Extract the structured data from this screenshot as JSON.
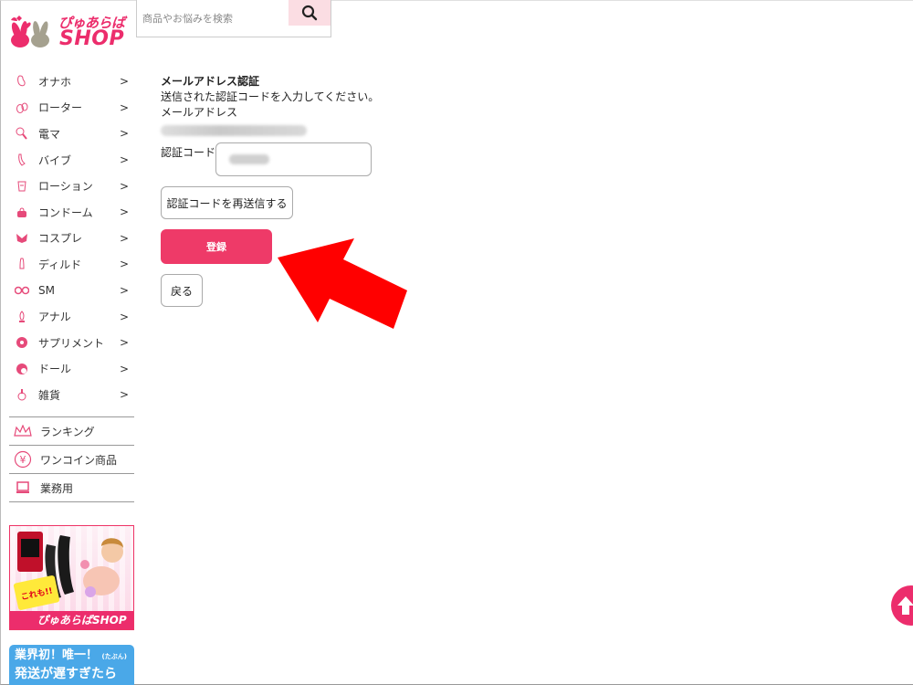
{
  "header": {
    "logo_text_jp": "ぴゅあらば",
    "logo_text_en": "SHOP",
    "search_placeholder": "商品やお悩みを検索"
  },
  "sidebar": {
    "categories": [
      {
        "label": "オナホ",
        "arrow": ">",
        "icon": "onahole-icon"
      },
      {
        "label": "ローター",
        "arrow": ">",
        "icon": "rotor-icon"
      },
      {
        "label": "電マ",
        "arrow": ">",
        "icon": "massager-icon"
      },
      {
        "label": "バイブ",
        "arrow": ">",
        "icon": "vibe-icon"
      },
      {
        "label": "ローション",
        "arrow": ">",
        "icon": "lotion-icon"
      },
      {
        "label": "コンドーム",
        "arrow": ">",
        "icon": "condom-icon"
      },
      {
        "label": "コスプレ",
        "arrow": ">",
        "icon": "cosplay-icon"
      },
      {
        "label": "ディルド",
        "arrow": ">",
        "icon": "dildo-icon"
      },
      {
        "label": "SM",
        "arrow": ">",
        "icon": "sm-icon"
      },
      {
        "label": "アナル",
        "arrow": ">",
        "icon": "anal-icon"
      },
      {
        "label": "サプリメント",
        "arrow": ">",
        "icon": "supplement-icon"
      },
      {
        "label": "ドール",
        "arrow": ">",
        "icon": "doll-icon"
      },
      {
        "label": "雑貨",
        "arrow": ">",
        "icon": "goods-icon"
      }
    ],
    "links": [
      {
        "label": "ランキング",
        "icon": "crown-icon"
      },
      {
        "label": "ワンコイン商品",
        "icon": "yen-icon"
      },
      {
        "label": "業務用",
        "icon": "computer-icon"
      }
    ],
    "banner1": {
      "badge": "これも!!",
      "footer": "ぴゅあらばSHOP"
    },
    "banner2": {
      "line1": "業界初！唯一！",
      "line1_small": "(たぶん)",
      "line2": "発送が遅すぎたら"
    }
  },
  "main": {
    "title": "メールアドレス認証",
    "instruction": "送信された認証コードを入力してください。",
    "email_label": "メールアドレス",
    "code_label": "認証コード",
    "resend_label": "認証コードを再送信する",
    "register_label": "登録",
    "back_label": "戻る"
  },
  "colors": {
    "accent": "#ee3a68",
    "arrow": "#ff0000",
    "search_button_bg": "#fbdde3"
  }
}
